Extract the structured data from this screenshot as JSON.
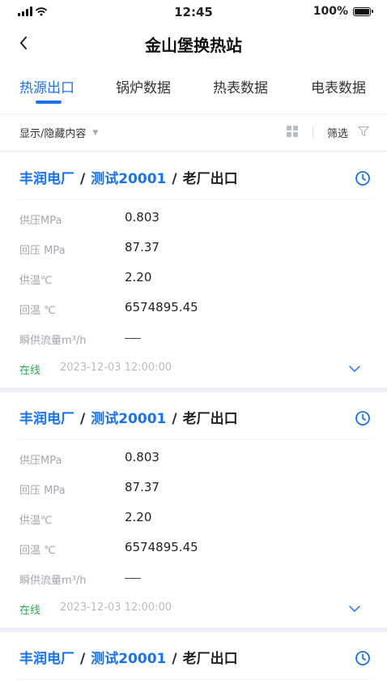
{
  "status_bar": {
    "time": "12:45",
    "battery": "100%"
  },
  "nav": {
    "title": "金山堡换热站"
  },
  "tabs": [
    {
      "label": "热源出口",
      "active": true
    },
    {
      "label": "锅炉数据",
      "active": false
    },
    {
      "label": "热表数据",
      "active": false
    },
    {
      "label": "电表数据",
      "active": false
    }
  ],
  "filter_bar": {
    "toggle_label": "显示/隐藏内容",
    "filter_label": "筛选"
  },
  "cards": [
    {
      "path": [
        "丰润电厂",
        "测试20001",
        "老厂出口"
      ],
      "fields": [
        {
          "label": "供压MPa",
          "value": "0.803"
        },
        {
          "label": "回压 MPa",
          "value": "87.37"
        },
        {
          "label": "供温℃",
          "value": "2.20"
        },
        {
          "label": "回温 ℃",
          "value": "6574895.45"
        },
        {
          "label": "瞬供流量m³/h",
          "value": ""
        }
      ],
      "status": "在线",
      "timestamp": "2023-12-03 12:00:00"
    },
    {
      "path": [
        "丰润电厂",
        "测试20001",
        "老厂出口"
      ],
      "fields": [
        {
          "label": "供压MPa",
          "value": "0.803"
        },
        {
          "label": "回压 MPa",
          "value": "87.37"
        },
        {
          "label": "供温℃",
          "value": "2.20"
        },
        {
          "label": "回温 ℃",
          "value": "6574895.45"
        },
        {
          "label": "瞬供流量m³/h",
          "value": ""
        }
      ],
      "status": "在线",
      "timestamp": "2023-12-03 12:00:00"
    },
    {
      "path": [
        "丰润电厂",
        "测试20001",
        "老厂出口"
      ]
    }
  ],
  "colors": {
    "accent": "#1a73e8",
    "online": "#22b14c",
    "label": "#a2a7ae"
  },
  "icons": [
    "signal-icon",
    "wifi-icon",
    "battery-icon",
    "back-icon",
    "grid-icon",
    "filter-icon",
    "clock-icon",
    "chevron-down-icon"
  ]
}
